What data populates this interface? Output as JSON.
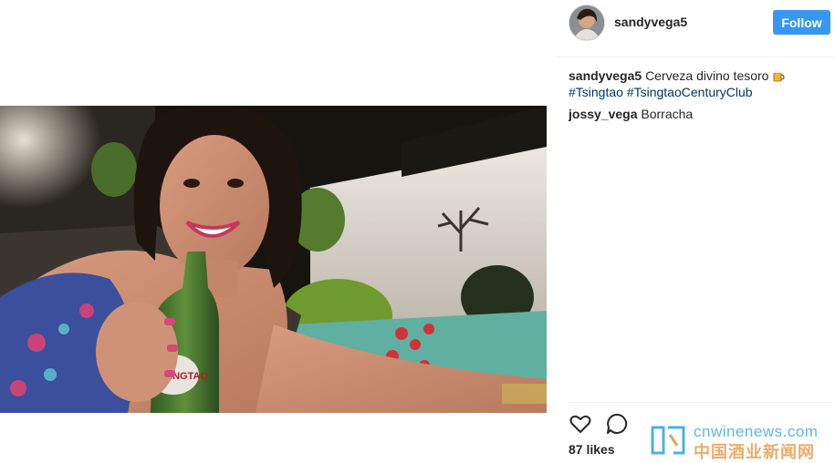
{
  "post": {
    "author": "sandyvega5",
    "follow_label": "Follow",
    "caption": {
      "user": "sandyvega5",
      "text": "Cerveza divino tesoro",
      "emoji": "beer-mug-icon",
      "hashtags": [
        "#Tsingtao",
        "#TsingtaoCenturyClub"
      ]
    },
    "comments": [
      {
        "user": "jossy_vega",
        "text": "Borracha"
      }
    ],
    "likes": "87 likes"
  },
  "watermark": {
    "domain": "cnwinenews.com",
    "chinese": "中国酒业新闻网"
  },
  "colors": {
    "follow_bg": "#3897f0",
    "hashtag": "#003569",
    "watermark_blue": "#4db0e8",
    "watermark_orange": "#e9a25a"
  }
}
